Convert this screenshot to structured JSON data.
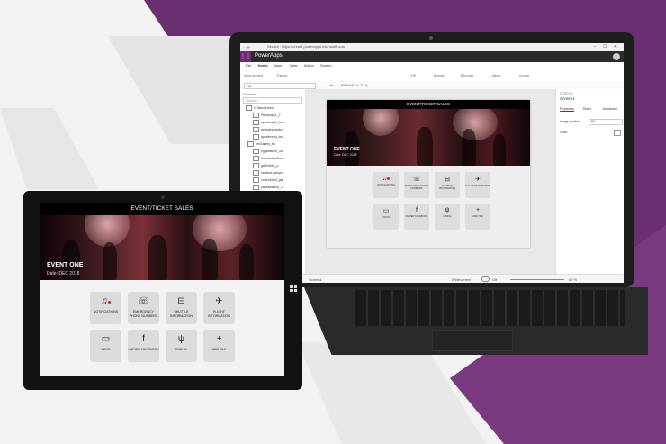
{
  "browser": {
    "url_text": "Secure · https://create.powerapps.microsoft.com",
    "controls": "– ☐ ✕"
  },
  "app": {
    "name": "PowerApps",
    "ribbon_tabs": [
      "File",
      "Home",
      "Insert",
      "View",
      "Action",
      "Screen"
    ],
    "active_tab": "Home",
    "tools": [
      "New screen",
      "Theme",
      "Fill",
      "Border",
      "Reorder",
      "Align",
      "Group"
    ],
    "property": "Fill",
    "formula": "RGBA(0, 0, 0, 1)",
    "panel_title": "Screens",
    "search_placeholder": "Search",
    "tree_items": [
      "HiTabsScreen",
      "Rectangle1_2",
      "appsforsale_boo",
      "appsdescription",
      "appsthread_list",
      "btnGallery_txt",
      "eggbalance_incl",
      "SubmissionForm",
      "galEntries_p",
      "captionLaptops",
      "controlHost_gal",
      "panelbuttons_1"
    ],
    "right_panel": {
      "section": "SCREEN",
      "screen_name": "Screen1",
      "tabs": [
        "Properties",
        "Rules",
        "Advanced"
      ],
      "prop1": "Image position",
      "prop1_value": "Fit",
      "prop2": "Color"
    },
    "status": {
      "screen_label": "Screen1",
      "zoom_label": "Widescreen",
      "toggle_label": "Off",
      "zoom_value": "60 %"
    }
  },
  "event_app": {
    "header": "EVENT/TICKET SALES",
    "event_title": "EVENT ONE",
    "event_date": "Date: DEC 2018",
    "tiles": [
      {
        "label": "NOTIFICATIONS",
        "icon": "bell-icon",
        "glyph": "🔔"
      },
      {
        "label": "EMERGENCY PHONE NUMBERS",
        "icon": "phone-book-icon",
        "glyph": "☏"
      },
      {
        "label": "SHUTTLE INFORMATION",
        "icon": "bus-icon",
        "glyph": "⊟"
      },
      {
        "label": "FLIGHT INFORMATION",
        "icon": "plane-icon",
        "glyph": "✈"
      },
      {
        "label": "VOXO",
        "icon": "video-icon",
        "glyph": "▭"
      },
      {
        "label": "KURIER FACEBOOK",
        "icon": "facebook-icon",
        "glyph": "f"
      },
      {
        "label": "DINING",
        "icon": "fork-knife-icon",
        "glyph": "ψ"
      },
      {
        "label": "ADD TILE",
        "icon": "plus-icon",
        "glyph": "+"
      }
    ]
  },
  "colors": {
    "brand_purple": "#742774",
    "alert_red": "#e02020"
  }
}
